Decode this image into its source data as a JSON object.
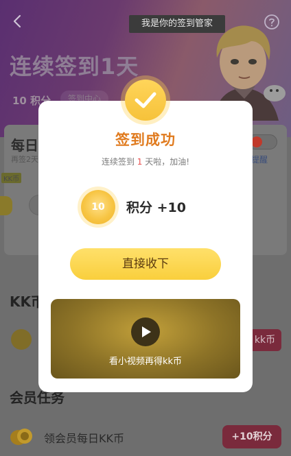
{
  "header": {
    "back_icon": "chevron-left-icon",
    "guide_text": "我是你的签到管家",
    "help_icon": "question-circle-icon",
    "title": "连续签到1天",
    "points_tab": "10 积分",
    "reward_center_tab": "签到中心"
  },
  "daily_card": {
    "title": "每日",
    "subtitle": "再签2天",
    "kk_tag": "KK币",
    "remind_label": "提醒",
    "toggle_on": true
  },
  "kk_section": {
    "title": "KK币",
    "row_button": "kk币"
  },
  "member_section": {
    "title": "会员任务",
    "item_label": "领会员每日KK币",
    "item_button": "+10积分"
  },
  "modal": {
    "check_icon": "check-icon",
    "title": "签到成功",
    "sub_prefix": "连续签到 ",
    "sub_days": "1",
    "sub_suffix": " 天啦，加油!",
    "coin_value": "10",
    "reward_text": "积分 +10",
    "collect_button": "直接收下",
    "video_icon": "play-icon",
    "video_label": "看小视频再得kk币"
  },
  "colors": {
    "accent_orange": "#e07b1f",
    "button_yellow": "#f9cf3d",
    "highlight_red": "#e94c4c"
  }
}
